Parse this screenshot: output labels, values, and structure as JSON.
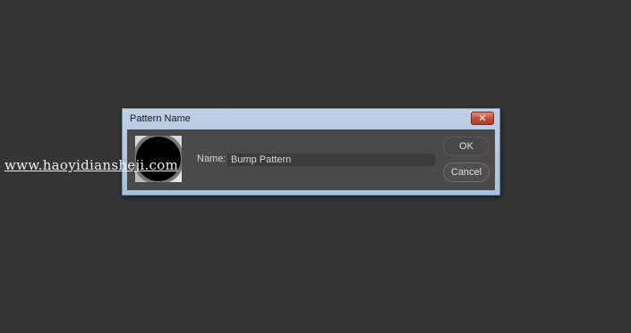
{
  "dialog": {
    "title": "Pattern Name",
    "close_symbol": "✕",
    "close_icon": "close-icon",
    "thumbnail_icon": "pattern-preview",
    "name_label": "Name:",
    "name_value": "Bump Pattern",
    "ok_label": "OK",
    "cancel_label": "Cancel"
  },
  "watermark": "www.haoyidiansheji.com",
  "colors": {
    "workspace": "#353535",
    "titlebar": "#bdd0e6",
    "client": "#4a4a4a",
    "close_button": "#c44a35"
  }
}
